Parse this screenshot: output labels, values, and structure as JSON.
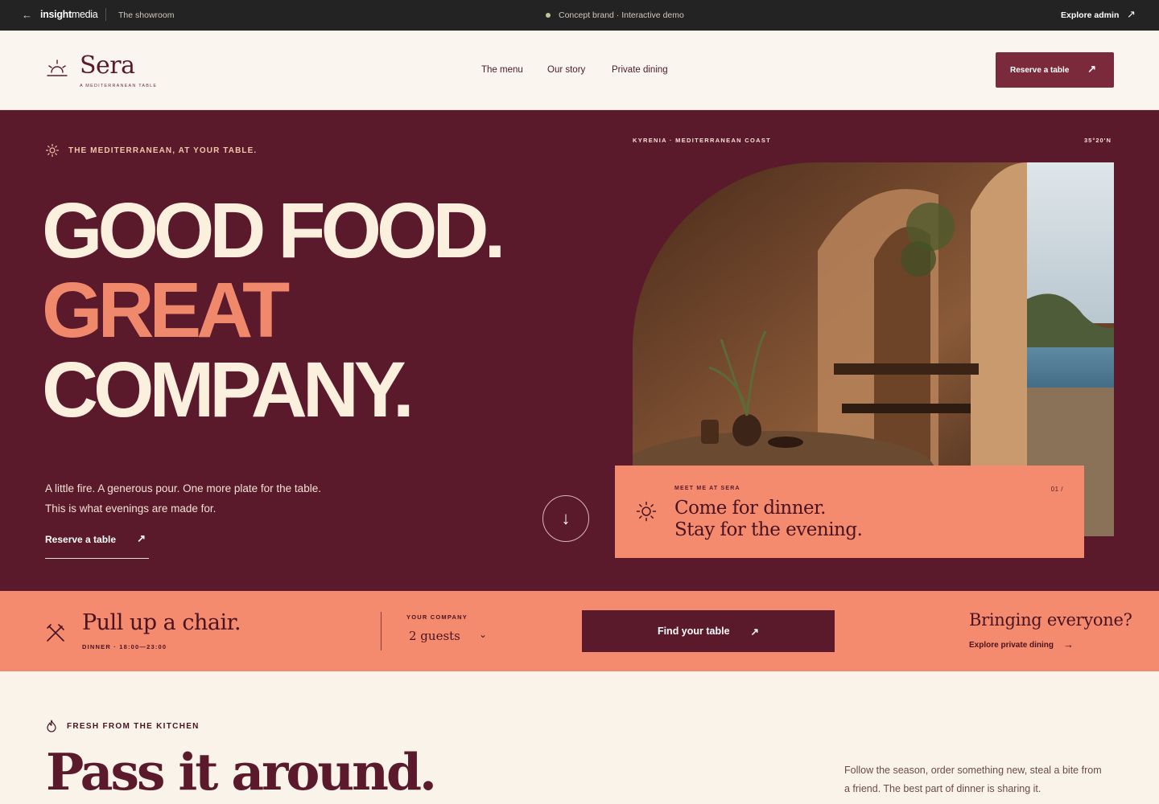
{
  "demo_bar": {
    "brand_bold": "insight",
    "brand_light": "media",
    "showroom": "The showroom",
    "concept": "Concept brand · Interactive demo",
    "explore": "Explore admin"
  },
  "header": {
    "logo_name": "Sera",
    "logo_tagline": "A MEDITERRANEAN TABLE",
    "nav": [
      "The menu",
      "Our story",
      "Private dining"
    ],
    "reserve": "Reserve a table"
  },
  "hero": {
    "eyebrow": "THE MEDITERRANEAN, AT YOUR TABLE.",
    "headline_1": "GOOD FOOD.",
    "headline_2": "GREAT",
    "headline_3": "COMPANY.",
    "description": "A little fire. A generous pour. One more plate for the table. This is what evenings are made for.",
    "cta": "Reserve a table",
    "location": "KYRENIA · MEDITERRANEAN COAST",
    "coords": "35°20'N",
    "card": {
      "kicker": "MEET ME AT SERA",
      "number": "01 /",
      "line1": "Come for dinner.",
      "line2": "Stay for the evening."
    }
  },
  "booking": {
    "title": "Pull up a chair.",
    "hours": "DINNER · 18:00—23:00",
    "company_label": "YOUR COMPANY",
    "guests": "2 guests",
    "find": "Find your table",
    "bringing": "Bringing everyone?",
    "private_link": "Explore private dining"
  },
  "kitchen": {
    "label": "FRESH FROM THE KITCHEN",
    "heading": "Pass it around.",
    "paragraph": "Follow the season, order something new, steal a bite from a friend. The best part of dinner is sharing it."
  },
  "colors": {
    "wine": "#5b192c",
    "coral": "#f48b6e",
    "cream": "#faf3ea",
    "dark_bar": "#232323"
  },
  "icons": [
    "arrow-left-icon",
    "arrow-up-right-icon",
    "sunrise-icon",
    "sun-icon",
    "arrow-down-icon",
    "utensils-crossed-icon",
    "chevron-down-icon",
    "arrow-right-icon",
    "flame-icon"
  ]
}
